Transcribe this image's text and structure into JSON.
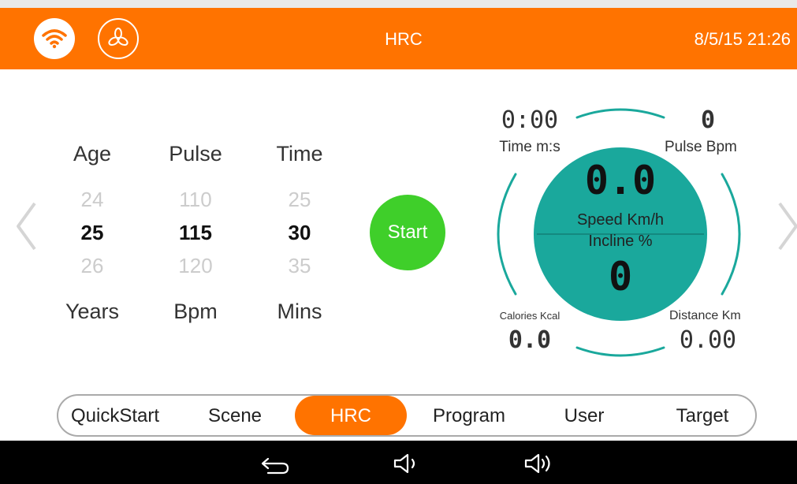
{
  "header": {
    "title": "HRC",
    "datetime": "8/5/15 21:26"
  },
  "icons": {
    "wifi": "wifi-icon",
    "fan": "fan-icon",
    "back": "back-arrow-icon",
    "volume_down": "volume-down-icon",
    "volume_up": "volume-up-icon"
  },
  "colors": {
    "accent": "#ff7300",
    "start": "#3fcf2a",
    "gauge": "#1aa89c"
  },
  "settings": {
    "age": {
      "label": "Age",
      "prev": "24",
      "value": "25",
      "next": "26",
      "unit": "Years"
    },
    "pulse": {
      "label": "Pulse",
      "prev": "110",
      "value": "115",
      "next": "120",
      "unit": "Bpm"
    },
    "time": {
      "label": "Time",
      "prev": "25",
      "value": "30",
      "next": "35",
      "unit": "Mins"
    }
  },
  "start_label": "Start",
  "gauge": {
    "time_value": "0:00",
    "time_label": "Time m:s",
    "pulse_value": "0",
    "pulse_label": "Pulse Bpm",
    "speed_value": "0.0",
    "speed_label": "Speed Km/h",
    "incline_label": "Incline %",
    "incline_value": "0",
    "calories_label": "Calories Kcal",
    "calories_value": "0.0",
    "distance_label": "Distance Km",
    "distance_value": "0.00"
  },
  "tabs": [
    "QuickStart",
    "Scene",
    "HRC",
    "Program",
    "User",
    "Target"
  ],
  "active_tab": "HRC"
}
